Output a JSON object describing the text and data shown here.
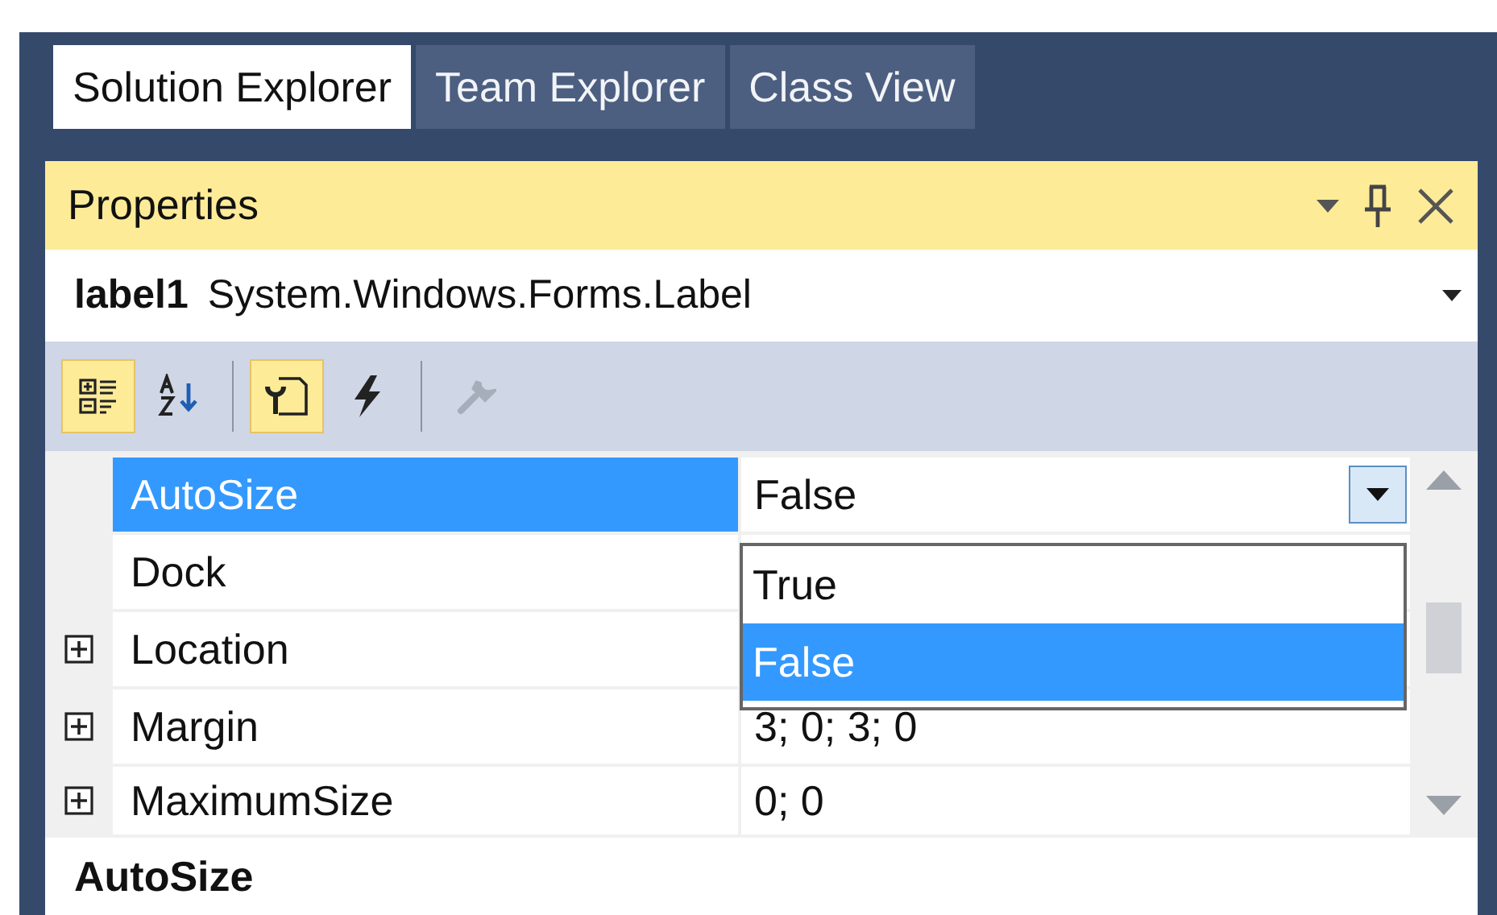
{
  "tabs": [
    {
      "label": "Solution Explorer",
      "selected": true
    },
    {
      "label": "Team Explorer",
      "selected": false
    },
    {
      "label": "Class View",
      "selected": false
    }
  ],
  "panel": {
    "title": "Properties"
  },
  "object_selector": {
    "name": "label1",
    "type": "System.Windows.Forms.Label"
  },
  "toolbar": [
    {
      "kind": "categorized",
      "selected": true,
      "disabled": false
    },
    {
      "kind": "alphabetical",
      "selected": false,
      "disabled": false
    },
    {
      "kind": "separator"
    },
    {
      "kind": "properties",
      "selected": true,
      "disabled": false
    },
    {
      "kind": "events",
      "selected": false,
      "disabled": false
    },
    {
      "kind": "separator"
    },
    {
      "kind": "property-pages",
      "selected": false,
      "disabled": true
    }
  ],
  "properties": [
    {
      "name": "AutoSize",
      "value": "False",
      "expandable": false,
      "selected": true,
      "dropdown": true
    },
    {
      "name": "Dock",
      "expandable": false,
      "selected": false
    },
    {
      "name": "Location",
      "expandable": true,
      "selected": false
    },
    {
      "name": "Margin",
      "value": "3; 0; 3; 0",
      "expandable": true,
      "selected": false
    },
    {
      "name": "MaximumSize",
      "value": "0; 0",
      "expandable": true,
      "selected": false
    }
  ],
  "dropdown_list": [
    {
      "label": "True",
      "selected": false
    },
    {
      "label": "False",
      "selected": true
    }
  ],
  "description": {
    "title": "AutoSize"
  }
}
